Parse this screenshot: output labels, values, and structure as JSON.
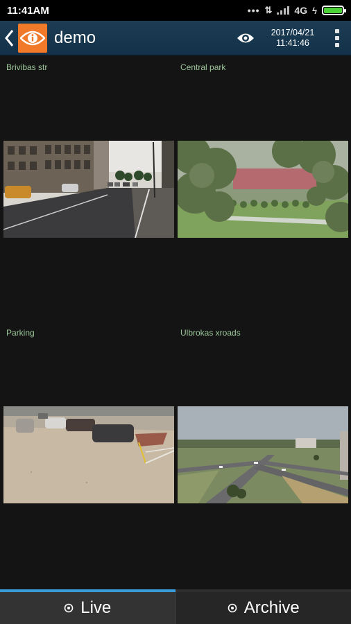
{
  "status_bar": {
    "time": "11:41AM",
    "network": "4G",
    "battery_level": 1.0,
    "battery_color": "#4cd137"
  },
  "header": {
    "back_icon": "chevron-left-icon",
    "logo_icon": "eye-logo-icon",
    "title": "demo",
    "view_icon": "eye-icon",
    "date": "2017/04/21",
    "time": "11:41:46",
    "menu_icon": "more-vertical-icon"
  },
  "cameras": [
    {
      "label": "Brivibas str",
      "scene": "street"
    },
    {
      "label": "Central park",
      "scene": "park"
    },
    {
      "label": "Parking",
      "scene": "parking"
    },
    {
      "label": "Ulbrokas xroads",
      "scene": "crossroads"
    }
  ],
  "tabs": [
    {
      "label": "Live",
      "icon": "live-dot-icon",
      "active": true
    },
    {
      "label": "Archive",
      "icon": "archive-dot-icon",
      "active": false
    }
  ],
  "colors": {
    "header_bg": "#1d3d55",
    "logo_bg": "#f07a2a",
    "camera_label": "#9cc79a",
    "active_tab_indicator": "#3a9bd9"
  }
}
